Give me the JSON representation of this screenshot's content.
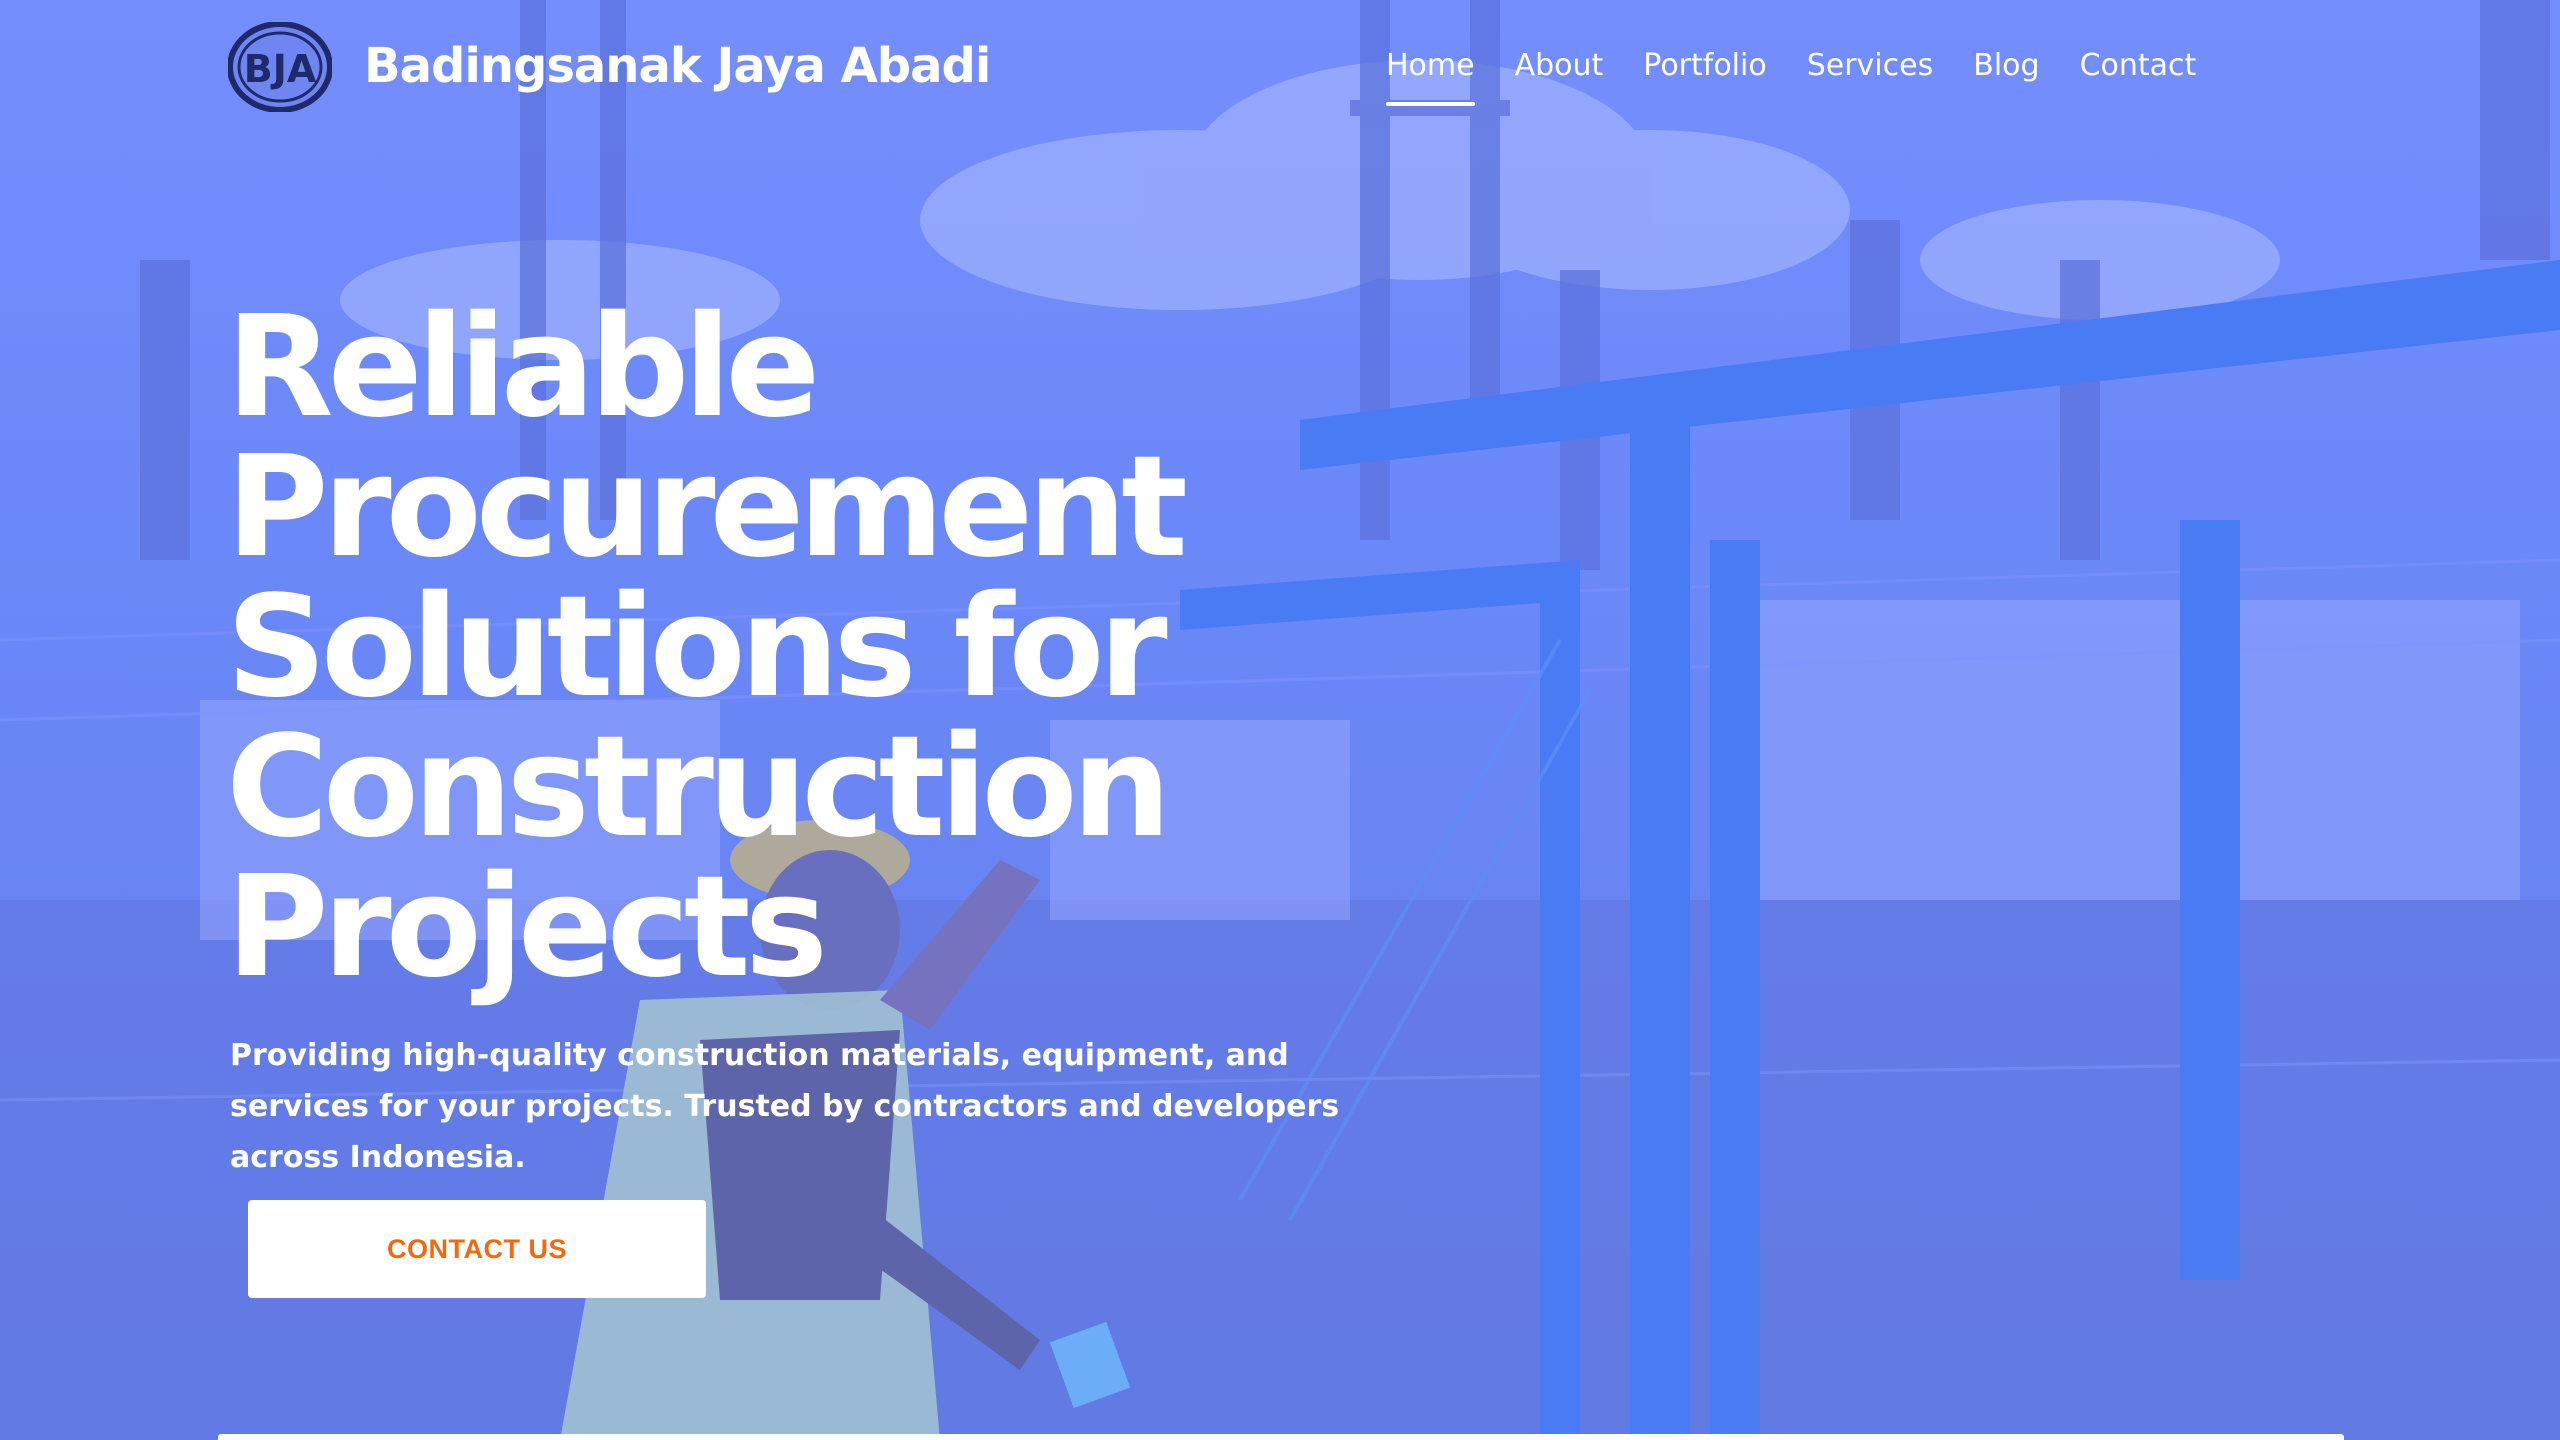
{
  "header": {
    "brand": "Badingsanak Jaya Abadi",
    "logo_text": "BJA",
    "nav": [
      {
        "label": "Home",
        "active": true
      },
      {
        "label": "About",
        "active": false
      },
      {
        "label": "Portfolio",
        "active": false
      },
      {
        "label": "Services",
        "active": false
      },
      {
        "label": "Blog",
        "active": false
      },
      {
        "label": "Contact",
        "active": false
      }
    ]
  },
  "hero": {
    "headline_lines": [
      "Reliable",
      "Procurement",
      "Solutions for",
      "Construction",
      "Projects"
    ],
    "subtext": "Providing high-quality construction materials, equipment, and services for your projects. Trusted by contractors and developers across Indonesia.",
    "cta_label": "CONTACT US"
  },
  "colors": {
    "overlay": "#6a86ee",
    "cta_text": "#f06a12",
    "text": "#ffffff",
    "logo_ring": "#1f2a6b"
  }
}
